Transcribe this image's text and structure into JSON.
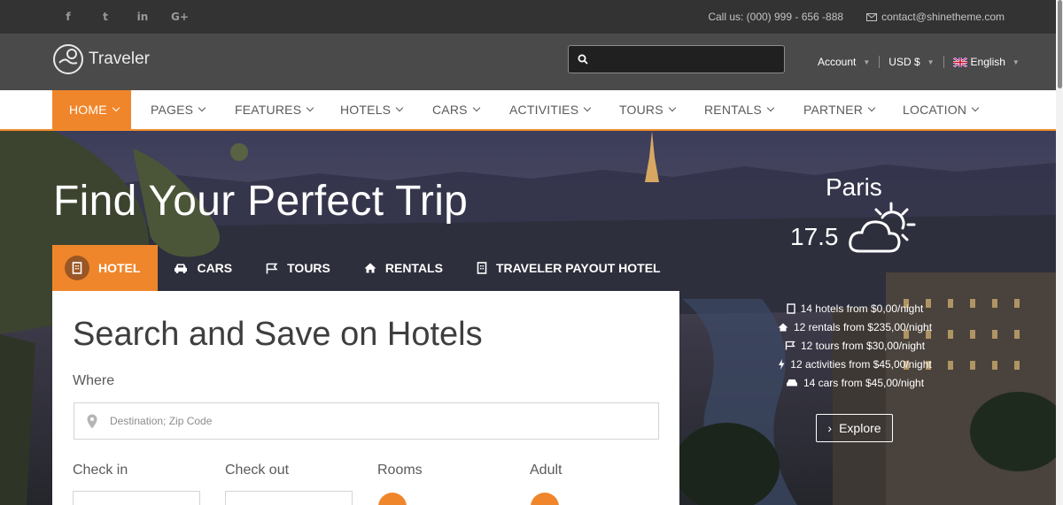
{
  "topbar": {
    "social": [
      {
        "name": "facebook-icon",
        "glyph": "f"
      },
      {
        "name": "twitter-icon",
        "glyph": "t"
      },
      {
        "name": "linkedin-icon",
        "glyph": "in"
      },
      {
        "name": "googleplus-icon",
        "glyph": "G+"
      }
    ],
    "call": "Call us: (000) 999 - 656 -888",
    "email": "contact@shinetheme.com"
  },
  "header": {
    "logo": "Traveler",
    "search_placeholder": "",
    "account": "Account",
    "currency": "USD $",
    "language": "English"
  },
  "nav": {
    "items": [
      "HOME",
      "PAGES",
      "FEATURES",
      "HOTELS",
      "CARS",
      "ACTIVITIES",
      "TOURS",
      "RENTALS",
      "PARTNER",
      "LOCATION"
    ]
  },
  "hero": {
    "title": "Find Your Perfect Trip",
    "tabs": [
      "HOTEL",
      "CARS",
      "TOURS",
      "RENTALS",
      "TRAVELER PAYOUT HOTEL"
    ],
    "panel_title": "Search and Save on Hotels",
    "where_label": "Where",
    "destination_placeholder": "Destination; Zip Code",
    "checkin_label": "Check in",
    "checkout_label": "Check out",
    "rooms_label": "Rooms",
    "adult_label": "Adult"
  },
  "weather": {
    "city": "Paris",
    "temp": "17.5",
    "icon": "partly-cloudy-icon"
  },
  "stats": [
    "14 hotels from $0,00/night",
    "12 rentals from $235,00/night",
    "12 tours from $30,00/night",
    "12 activities from $45,00/night",
    "14 cars from $45,00/night"
  ],
  "explore_label": "Explore",
  "colors": {
    "accent": "#f0862b",
    "topbar": "#333333",
    "header": "#4a4a4a"
  }
}
